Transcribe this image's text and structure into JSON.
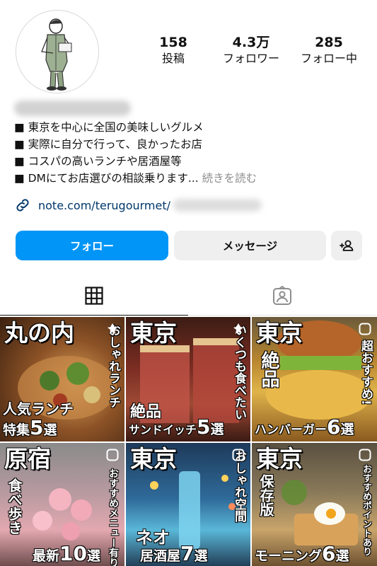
{
  "profile": {
    "stats": [
      {
        "value": "158",
        "label": "投稿"
      },
      {
        "value": "4.3万",
        "label": "フォロワー"
      },
      {
        "value": "285",
        "label": "フォロー中"
      }
    ],
    "bio": [
      "■ 東京を中心に全国の美味しいグルメ",
      "■ 実際に自分で行って、良かったお店",
      "■ コスパの高いランチや居酒屋等",
      "■ DMにてお店選びの相談乗ります..."
    ],
    "more_label": "続きを読む",
    "link": "note.com/terugourmet/"
  },
  "buttons": {
    "follow": "フォロー",
    "message": "メッセージ",
    "suggest_icon": "add-person-icon"
  },
  "tabs": [
    {
      "icon": "grid-icon",
      "active": true
    },
    {
      "icon": "tagged-person-icon",
      "active": false
    }
  ],
  "posts": [
    {
      "head": "丸の内",
      "side": "おしゃれランチ",
      "bottom_top": "人気ランチ",
      "bottom": "特集",
      "num": "5",
      "suffix": "選",
      "icon": "pin-icon",
      "bg": "#7a4a22"
    },
    {
      "head": "東京",
      "side": "いくつも食べたい",
      "mid": "絶品",
      "bottom": "サンドイッチ",
      "num": "5",
      "suffix": "選",
      "icon": "pin-icon",
      "bg": "#5c2a1c"
    },
    {
      "head": "東京",
      "side": "超おすすめ!",
      "vert": "絶品",
      "bottom": "ハンバーガー",
      "num": "6",
      "suffix": "選",
      "icon": "reel-icon",
      "bg": "#b8862f"
    },
    {
      "head": "原宿",
      "side": "おすすめメニュー有り",
      "vert": "食べ歩き",
      "bottom": "最新",
      "num": "10",
      "suffix": "選",
      "icon": "reel-icon",
      "bg": "#c9787e"
    },
    {
      "head": "東京",
      "side": "おしゃれ空間",
      "mid": "ネオ",
      "bottom": "居酒屋",
      "num": "7",
      "suffix": "選",
      "icon": "reel-icon",
      "bg": "#2c5f86"
    },
    {
      "head": "東京",
      "side": "おすすめポイントあり",
      "vert": "保存版",
      "bottom": "モーニング",
      "num": "6",
      "suffix": "選",
      "icon": "reel-icon",
      "bg": "#8a7a5a"
    }
  ]
}
